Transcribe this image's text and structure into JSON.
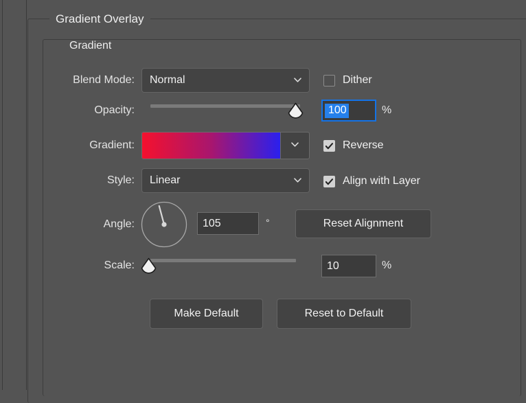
{
  "panel": {
    "outer_group_title": "Gradient Overlay",
    "inner_group_title": "Gradient"
  },
  "fields": {
    "blend_mode": {
      "label": "Blend Mode:",
      "value": "Normal"
    },
    "opacity": {
      "label": "Opacity:",
      "value": "100",
      "unit": "%",
      "slider_percent": 100
    },
    "gradient": {
      "label": "Gradient:",
      "color_start": "#F4112E",
      "color_mid": "#A8166E",
      "color_end": "#2A20EE"
    },
    "style": {
      "label": "Style:",
      "value": "Linear"
    },
    "angle": {
      "label": "Angle:",
      "value": "105",
      "unit": "°"
    },
    "scale": {
      "label": "Scale:",
      "value": "10",
      "unit": "%",
      "slider_percent": 0
    }
  },
  "checkboxes": {
    "dither": {
      "label": "Dither",
      "checked": false
    },
    "reverse": {
      "label": "Reverse",
      "checked": true
    },
    "align_with_layer": {
      "label": "Align with Layer",
      "checked": true
    }
  },
  "buttons": {
    "reset_alignment": "Reset Alignment",
    "make_default": "Make Default",
    "reset_to_default": "Reset to Default"
  },
  "colors": {
    "panel_background": "#545454",
    "focus_blue": "#1473E6",
    "selection_blue": "#2680EB",
    "control_background": "#434343",
    "input_background": "#3B3B3B"
  }
}
